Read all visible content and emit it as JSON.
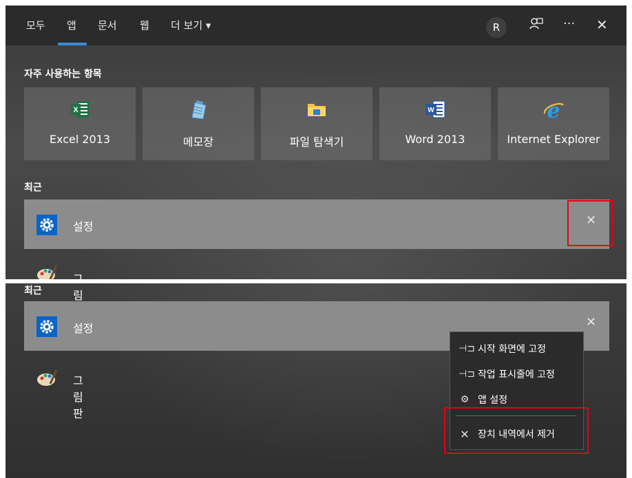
{
  "tabs": [
    {
      "label": "모두"
    },
    {
      "label": "앱"
    },
    {
      "label": "문서"
    },
    {
      "label": "웹"
    },
    {
      "label": "더 보기 ▾"
    }
  ],
  "user": {
    "avatar_letter": "R"
  },
  "icons": {
    "feedback": "feedback-icon",
    "more": "···",
    "close": "✕"
  },
  "frequent": {
    "title": "자주 사용하는 항목",
    "items": [
      {
        "label": "Excel 2013",
        "icon": "excel-icon"
      },
      {
        "label": "메모장",
        "icon": "notepad-icon"
      },
      {
        "label": "파일 탐색기",
        "icon": "file-explorer-icon"
      },
      {
        "label": "Word 2013",
        "icon": "word-icon"
      },
      {
        "label": "Internet Explorer",
        "icon": "internet-explorer-icon"
      }
    ]
  },
  "recent": {
    "title": "최근",
    "items": [
      {
        "label": "설정",
        "icon": "settings-icon"
      },
      {
        "label": "그림판",
        "icon": "paint-icon"
      }
    ],
    "remove_glyph": "✕"
  },
  "context_menu": {
    "items": [
      {
        "label": "시작 화면에 고정",
        "icon": "pin-icon"
      },
      {
        "label": "작업 표시줄에 고정",
        "icon": "pin-icon"
      },
      {
        "label": "앱 설정",
        "icon": "gear-icon"
      },
      {
        "label": "장치 내역에서 제거",
        "icon": "close-icon"
      }
    ]
  },
  "colors": {
    "accent": "#3b8bd9",
    "highlight": "#e60012",
    "settings_blue": "#0a64c8"
  }
}
